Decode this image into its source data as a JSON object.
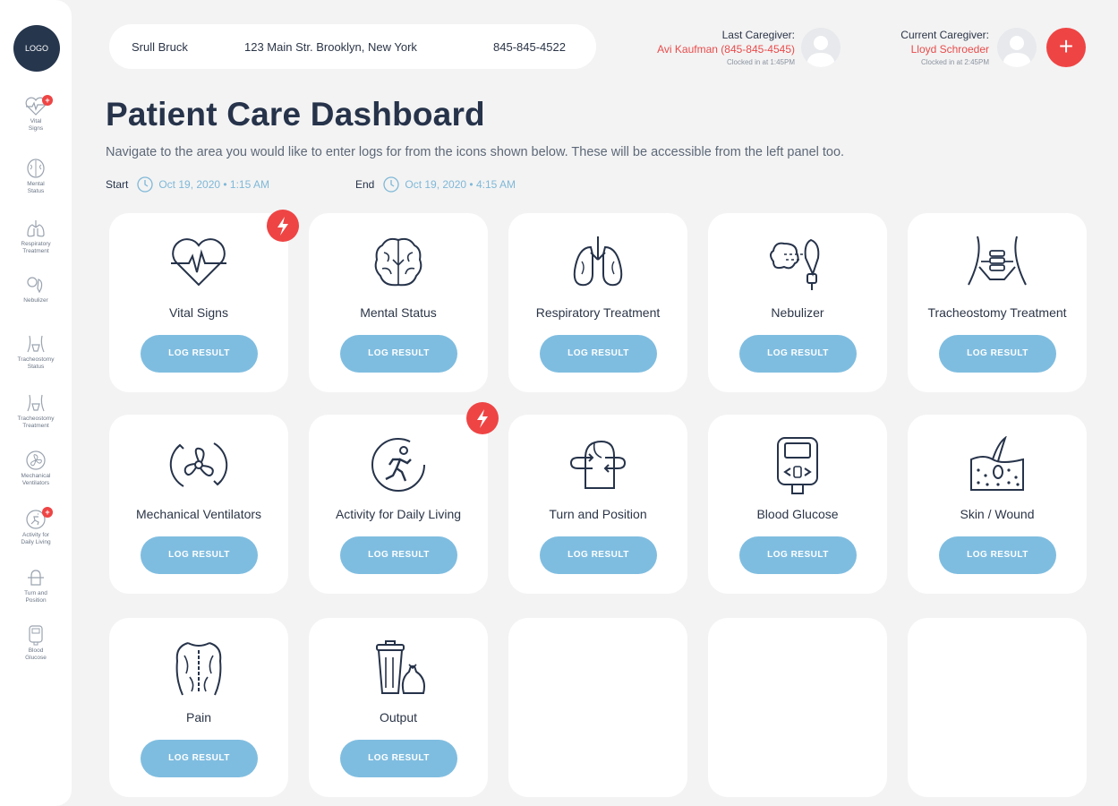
{
  "sidebar": {
    "logo": "LOGO",
    "items": [
      {
        "label": "Vital\nSigns",
        "icon": "heart-rate-icon",
        "badge": "+"
      },
      {
        "label": "Mental\nStatus",
        "icon": "brain-icon"
      },
      {
        "label": "Respiratory\nTreatment",
        "icon": "lungs-icon"
      },
      {
        "label": "Nebulizer",
        "icon": "nebulizer-icon"
      },
      {
        "label": "Tracheostomy\nStatus",
        "icon": "trachea-icon"
      },
      {
        "label": "Tracheostomy\nTreatment",
        "icon": "trachea-icon"
      },
      {
        "label": "Mechanical\nVentilators",
        "icon": "fan-icon"
      },
      {
        "label": "Activity for\nDaily Living",
        "icon": "runner-icon",
        "badge": "+"
      },
      {
        "label": "Turn and\nPosition",
        "icon": "turn-icon"
      },
      {
        "label": "Blood\nGlucose",
        "icon": "glucose-meter-icon"
      }
    ]
  },
  "patient": {
    "name": "Srull Bruck",
    "address": "123 Main Str. Brooklyn, New York",
    "phone": "845-845-4522"
  },
  "last_caregiver": {
    "title": "Last Caregiver:",
    "name": "Avi Kaufman (845-845-4545)",
    "clock": "Clocked in at 1:45PM"
  },
  "current_caregiver": {
    "title": "Current Caregiver:",
    "name": "Lloyd Schroeder",
    "clock": "Clocked in at 2:45PM"
  },
  "add_button": "+",
  "header": {
    "title": "Patient Care Dashboard",
    "subtitle": "Navigate to the area you would like to enter logs for from the icons shown below. These will be accessible from the left panel too."
  },
  "time": {
    "start_label": "Start",
    "start_value": "Oct 19, 2020  •  1:15 AM",
    "end_label": "End",
    "end_value": "Oct 19, 2020  •  4:15 AM"
  },
  "log_button": "LOG RESULT",
  "cards": [
    {
      "label": "Vital Signs",
      "icon": "heart-rate-icon",
      "alert": true
    },
    {
      "label": "Mental Status",
      "icon": "brain-icon"
    },
    {
      "label": "Respiratory Treatment",
      "icon": "lungs-icon"
    },
    {
      "label": "Nebulizer",
      "icon": "nebulizer-icon"
    },
    {
      "label": "Tracheostomy Treatment",
      "icon": "trachea-icon"
    },
    {
      "label": "Mechanical Ventilators",
      "icon": "fan-icon"
    },
    {
      "label": "Activity for Daily Living",
      "icon": "runner-icon",
      "alert": true
    },
    {
      "label": "Turn and Position",
      "icon": "turn-icon"
    },
    {
      "label": "Blood Glucose",
      "icon": "glucose-meter-icon"
    },
    {
      "label": "Skin / Wound",
      "icon": "skin-icon"
    },
    {
      "label": "Pain",
      "icon": "back-pain-icon"
    },
    {
      "label": "Output",
      "icon": "waste-bin-icon"
    }
  ],
  "colors": {
    "accent": "#7fbde0",
    "alert": "#ef4444",
    "navy": "#26334a",
    "background": "#f3f3f3"
  }
}
